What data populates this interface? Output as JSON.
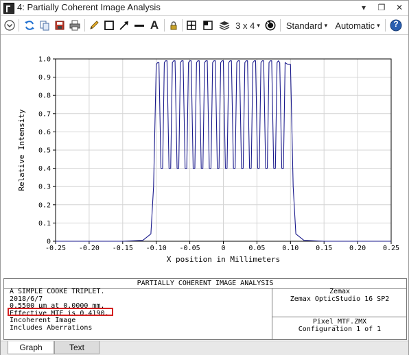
{
  "window": {
    "title": "4: Partially Coherent Image Analysis",
    "controls": {
      "pin": "▾",
      "restore": "❐",
      "close": "✕"
    }
  },
  "toolbar": {
    "layout_label": "3 x 4",
    "standard_label": "Standard",
    "automatic_label": "Automatic",
    "dropdown_arrow": "▾",
    "help_label": "?"
  },
  "plot": {
    "xlabel": "X position in Millimeters",
    "ylabel": "Relative Intensity"
  },
  "chart_data": {
    "type": "line",
    "xlabel": "X position in Millimeters",
    "ylabel": "Relative Intensity",
    "xlim": [
      -0.25,
      0.25
    ],
    "ylim": [
      0,
      1.0
    ],
    "x_ticks": [
      "-0.25",
      "-0.20",
      "-0.15",
      "-0.10",
      "-0.05",
      "0",
      "0.05",
      "0.10",
      "0.15",
      "0.20",
      "0.25"
    ],
    "y_ticks": [
      "0",
      "0.1",
      "0.2",
      "0.3",
      "0.4",
      "0.5",
      "0.6",
      "0.7",
      "0.8",
      "0.9",
      "1.0"
    ],
    "grid": true,
    "color": "#1a1a8c",
    "series": [
      {
        "x": [
          -0.25,
          -0.15,
          -0.12,
          -0.108,
          -0.104,
          -0.1,
          -0.098,
          -0.096,
          -0.093,
          -0.0905,
          -0.088,
          -0.086,
          -0.084,
          -0.081,
          -0.0785,
          -0.076,
          -0.074,
          -0.072,
          -0.069,
          -0.0665,
          -0.064,
          -0.062,
          -0.06,
          -0.057,
          -0.0545,
          -0.052,
          -0.05,
          -0.048,
          -0.045,
          -0.0425,
          -0.04,
          -0.038,
          -0.036,
          -0.033,
          -0.0305,
          -0.028,
          -0.026,
          -0.024,
          -0.021,
          -0.0185,
          -0.016,
          -0.014,
          -0.012,
          -0.009,
          -0.0065,
          -0.004,
          -0.002,
          0.0,
          0.003,
          0.0055,
          0.008,
          0.01,
          0.012,
          0.015,
          0.0175,
          0.02,
          0.022,
          0.024,
          0.027,
          0.0295,
          0.032,
          0.034,
          0.036,
          0.039,
          0.0415,
          0.044,
          0.046,
          0.048,
          0.051,
          0.0535,
          0.056,
          0.058,
          0.06,
          0.063,
          0.0655,
          0.068,
          0.07,
          0.072,
          0.075,
          0.0775,
          0.08,
          0.082,
          0.084,
          0.087,
          0.0895,
          0.092,
          0.096,
          0.1,
          0.104,
          0.108,
          0.12,
          0.15,
          0.25
        ],
        "y": [
          0.0,
          0.0,
          0.005,
          0.04,
          0.3,
          0.97,
          0.98,
          0.98,
          0.4,
          0.4,
          0.98,
          0.99,
          0.99,
          0.4,
          0.4,
          0.98,
          0.99,
          0.99,
          0.4,
          0.4,
          0.98,
          0.99,
          0.99,
          0.4,
          0.4,
          0.98,
          0.99,
          0.99,
          0.4,
          0.4,
          0.98,
          0.99,
          0.99,
          0.4,
          0.4,
          0.98,
          0.99,
          0.99,
          0.4,
          0.4,
          0.98,
          0.99,
          0.99,
          0.4,
          0.4,
          0.98,
          0.99,
          0.99,
          0.4,
          0.4,
          0.98,
          0.99,
          0.99,
          0.4,
          0.4,
          0.98,
          0.99,
          0.99,
          0.4,
          0.4,
          0.98,
          0.99,
          0.99,
          0.4,
          0.4,
          0.98,
          0.99,
          0.99,
          0.4,
          0.4,
          0.98,
          0.99,
          0.99,
          0.4,
          0.4,
          0.98,
          0.99,
          0.99,
          0.4,
          0.4,
          0.98,
          0.99,
          0.98,
          0.4,
          0.4,
          0.98,
          0.97,
          0.97,
          0.3,
          0.04,
          0.005,
          0.0,
          0.0
        ]
      }
    ]
  },
  "info": {
    "title": "PARTIALLY COHERENT IMAGE ANALYSIS",
    "left_lines": [
      "A SIMPLE COOKE TRIPLET.",
      "2018/6/7",
      "0.5500 µm at 0.0000 mm.",
      "Effective MTF is 0.4190.",
      "Incoherent Image",
      "Includes Aberrations"
    ],
    "right_top": [
      "Zemax",
      "Zemax OpticStudio 16 SP2"
    ],
    "right_bottom": [
      "Pixel_MTF.ZMX",
      "Configuration 1 of 1"
    ]
  },
  "tabs": [
    {
      "label": "Graph",
      "active": true
    },
    {
      "label": "Text",
      "active": false
    }
  ]
}
